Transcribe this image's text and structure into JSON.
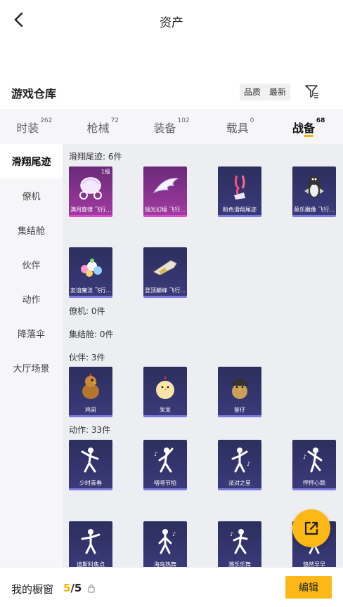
{
  "header": {
    "title": "资产"
  },
  "warehouse": {
    "title": "游戏仓库",
    "sort_options": [
      "品质",
      "最新"
    ]
  },
  "tabs": [
    {
      "label": "时装",
      "count": "262"
    },
    {
      "label": "枪械",
      "count": "72"
    },
    {
      "label": "装备",
      "count": "102"
    },
    {
      "label": "载具",
      "count": "0"
    },
    {
      "label": "战备",
      "count": "68"
    }
  ],
  "sidebar": [
    {
      "label": "滑翔尾迹"
    },
    {
      "label": "僚机"
    },
    {
      "label": "集结舱"
    },
    {
      "label": "伙伴"
    },
    {
      "label": "动作"
    },
    {
      "label": "降落伞"
    },
    {
      "label": "大厅场景"
    }
  ],
  "sections": {
    "glide": {
      "label": "滑翔尾迹: 6件",
      "items": [
        {
          "name": "满月旋律 飞行...",
          "level": "1级",
          "icon": "carriage-icon"
        },
        {
          "name": "镜光幻境 飞行...",
          "icon": "wing-icon"
        },
        {
          "name": "粉色滑翔尾迹",
          "icon": "pink-trail-icon"
        },
        {
          "name": "莫乐雕像 飞行...",
          "icon": "penguin-icon"
        },
        {
          "name": "友谊魔法 飞行...",
          "icon": "flower-icon"
        },
        {
          "name": "登顶巅峰 飞行...",
          "icon": "jet-icon"
        }
      ]
    },
    "wingman": {
      "label": "僚机: 0件"
    },
    "capsule": {
      "label": "集结舱: 0件"
    },
    "partner": {
      "label": "伙伴: 3件",
      "items": [
        {
          "name": "鸡哥",
          "icon": "chicken-icon"
        },
        {
          "name": "呆呆",
          "icon": "chick-icon"
        },
        {
          "name": "鉴仔",
          "icon": "soldier-chick-icon"
        }
      ]
    },
    "action": {
      "label": "动作: 33件",
      "items": [
        {
          "name": "少时青春",
          "icon": "dance-icon"
        },
        {
          "name": "嗒嗒节拍",
          "icon": "dance-icon"
        },
        {
          "name": "派对之星",
          "icon": "dance-icon"
        },
        {
          "name": "怦怦心跳",
          "icon": "dance-icon"
        },
        {
          "name": "迪斯科焦点",
          "icon": "dance-icon"
        },
        {
          "name": "海岛热舞",
          "icon": "dance-icon"
        },
        {
          "name": "潮乐乐舞",
          "icon": "dance-icon"
        },
        {
          "name": "悠然早早",
          "icon": "dance-icon"
        }
      ]
    }
  },
  "bottom": {
    "label": "我的橱窗",
    "current": "5",
    "separator": "/",
    "total": "5",
    "edit_label": "编辑"
  },
  "colors": {
    "accent": "#fbb817",
    "card_purple": "#2c2f5e",
    "card_pink": "#a03aa0"
  }
}
